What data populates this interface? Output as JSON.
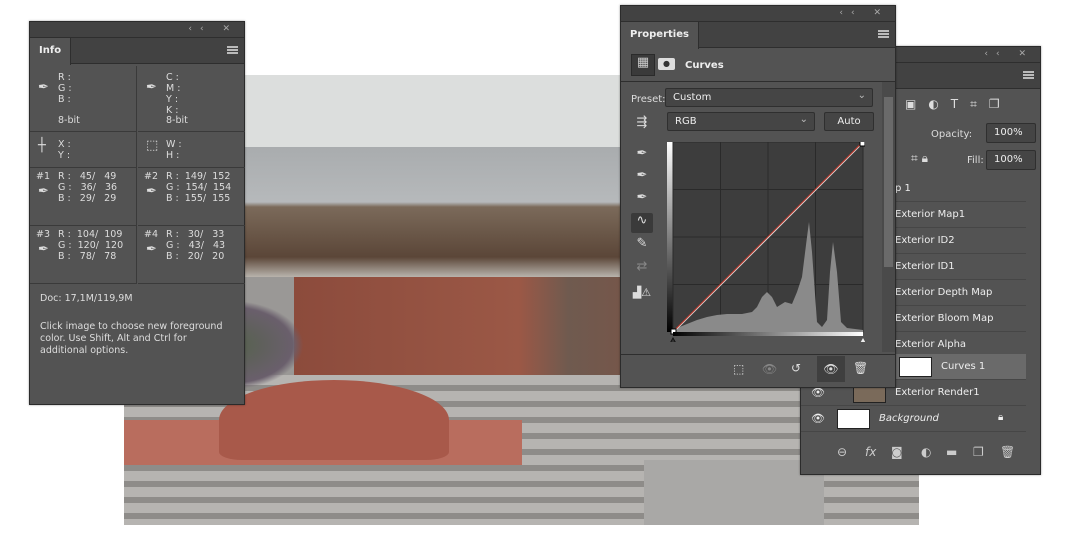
{
  "info": {
    "tab": "Info",
    "rgb_labels": "R :\nG :\nB :",
    "cmyk_labels": "C :\nM :\nY :\nK :",
    "bit1": "8-bit",
    "bit2": "8-bit",
    "xy_labels": "X :\nY :",
    "wh_labels": "W :\nH :",
    "samplers": [
      {
        "id": "#1",
        "values": "R :   45/   49\nG :   36/   36\nB :   29/   29"
      },
      {
        "id": "#2",
        "values": "R :  149/  152\nG :  154/  154\nB :  155/  155"
      },
      {
        "id": "#3",
        "values": "R :  104/  109\nG :  120/  120\nB :   78/   78"
      },
      {
        "id": "#4",
        "values": "R :   30/   33\nG :   43/   43\nB :   20/   20"
      }
    ],
    "doc": "Doc: 17,1M/119,9M",
    "help": "Click image to choose new foreground color.  Use Shift, Alt and Ctrl for additional options."
  },
  "properties": {
    "tab": "Properties",
    "title": "Curves",
    "preset_label": "Preset:",
    "preset_value": "Custom",
    "channel": "RGB",
    "auto": "Auto"
  },
  "layers": {
    "opacity_label": "Opacity:",
    "opacity": "100%",
    "fill_label": "Fill:",
    "fill": "100%",
    "items": [
      {
        "name": "p 1"
      },
      {
        "name": "Exterior Map1"
      },
      {
        "name": "Exterior ID2"
      },
      {
        "name": "Exterior ID1"
      },
      {
        "name": "Exterior Depth Map"
      },
      {
        "name": "Exterior Bloom Map"
      },
      {
        "name": "Exterior Alpha"
      },
      {
        "name": "Curves 1"
      },
      {
        "name": "Exterior Render1"
      },
      {
        "name": "Background"
      }
    ]
  },
  "colors": {
    "panel": "#535353",
    "curve_red": "#c0392b"
  }
}
